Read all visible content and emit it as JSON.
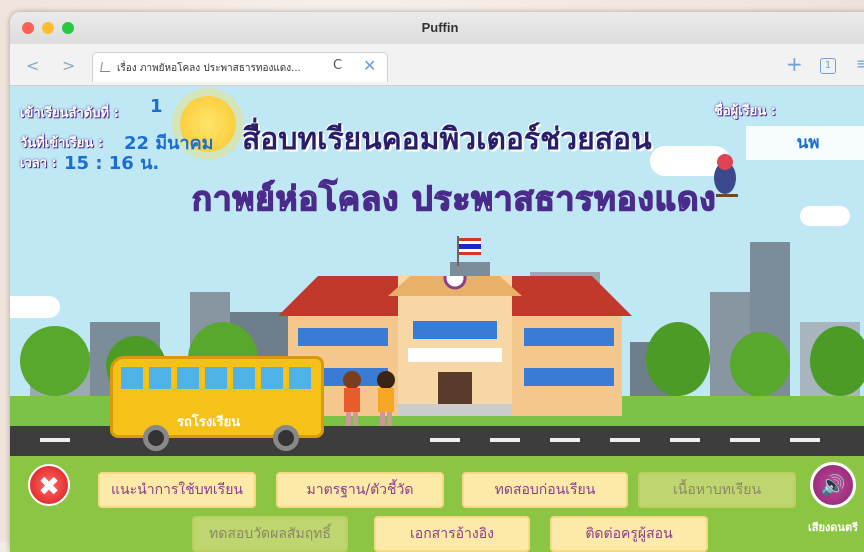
{
  "window": {
    "app_title": "Puffin",
    "tab_title": "เรื่อง ภาพยัหอโคลง ประพาสธารทองแดง...",
    "tab_count": "1",
    "back_glyph": "<",
    "forward_glyph": ">",
    "reload_glyph": "C",
    "close_glyph": "✕",
    "plus_glyph": "+",
    "menu_glyph": "≡"
  },
  "info": {
    "order_label": "เข้าเรียนลำดับที่ :",
    "order_value": "1",
    "date_label": "วันที่เข้าเรียน :",
    "date_value": "22 มีนาคม",
    "time_label": "เวลา :",
    "time_value": "15 : 16 น.",
    "name_label": "ชื่อผู้เรียน :",
    "name_value": "นพ"
  },
  "titles": {
    "line1": "สื่อบทเรียนคอมพิวเตอร์ช่วยสอน",
    "line2": "กาพย์ห่อโคลง ประพาสธารทองแดง"
  },
  "scene": {
    "bus_label": "รถโรงเรียน"
  },
  "menu": {
    "row1": [
      "แนะนำการใช้บทเรียน",
      "มาตรฐาน/ตัวชี้วัด",
      "ทดสอบก่อนเรียน",
      "เนื้อหาบทเรียน"
    ],
    "row2": [
      "ทดสอบวัดผลสัมฤทธิ์",
      "เอกสารอ้างอิง",
      "ติดต่อครูผู้สอน"
    ],
    "sound_label": "เสียงดนตรี",
    "close_glyph": "✖",
    "sound_glyph": "🔊"
  }
}
